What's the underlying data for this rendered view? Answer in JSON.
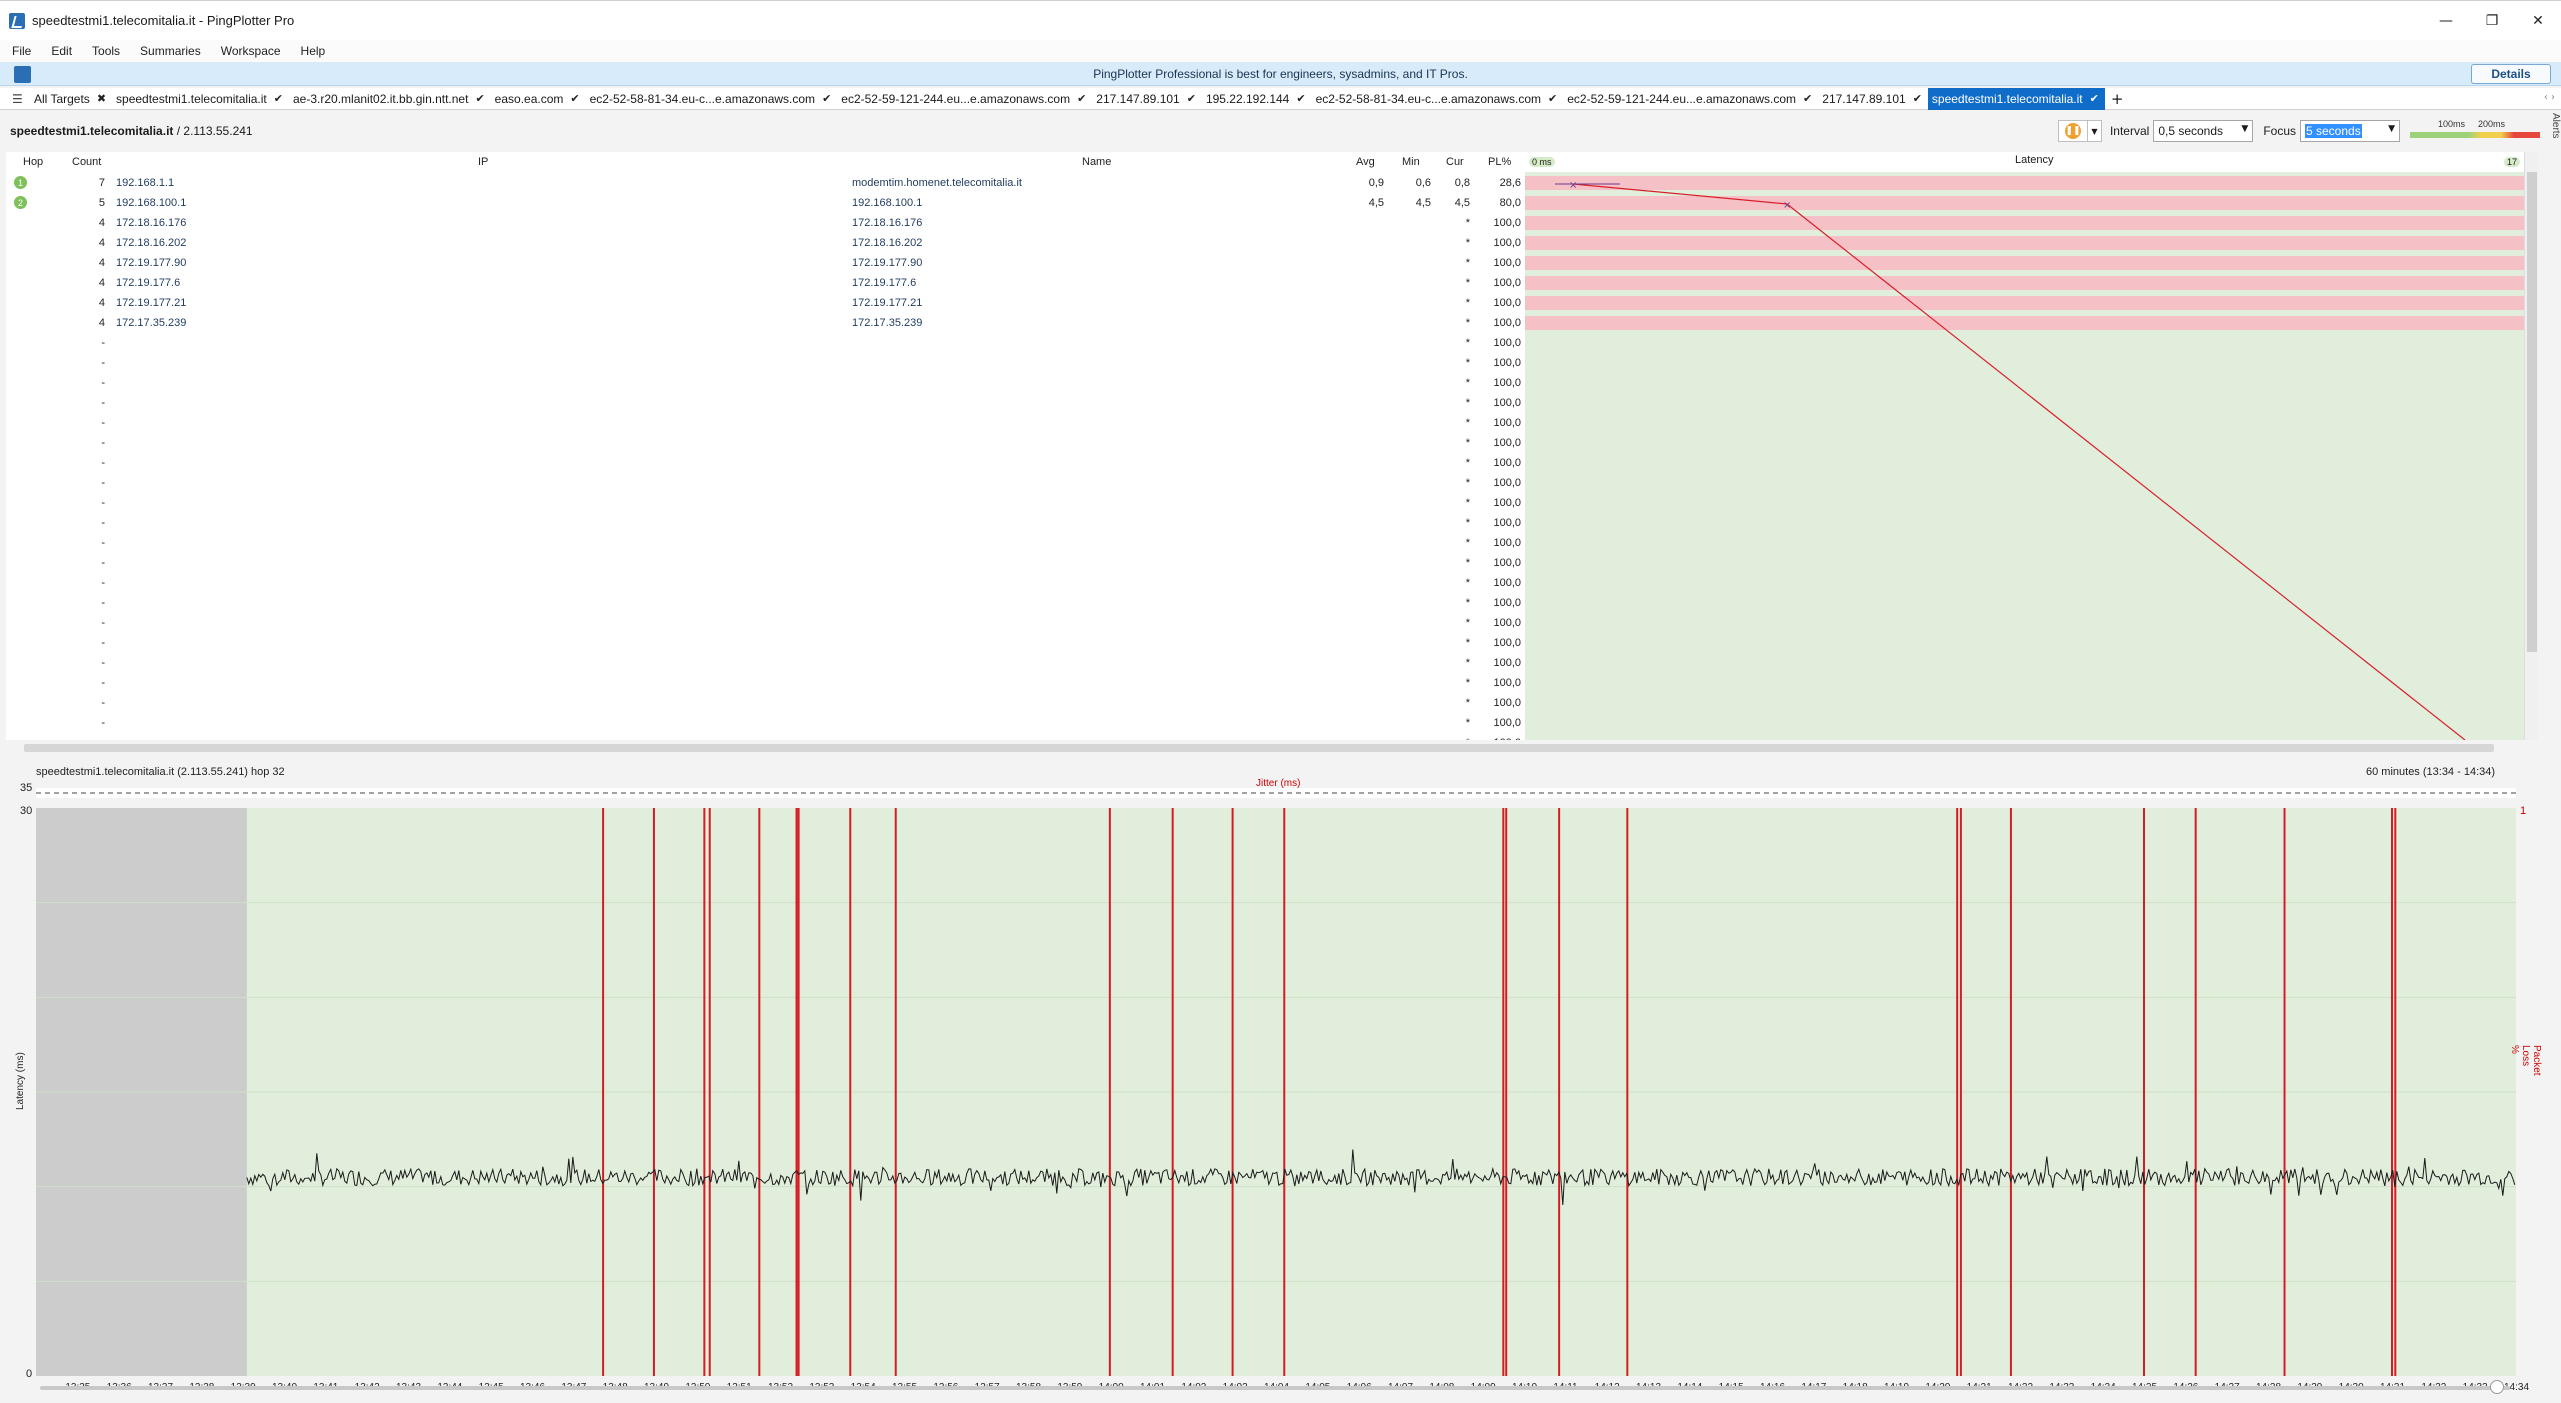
{
  "window": {
    "title": "speedtestmi1.telecomitalia.it - PingPlotter Pro",
    "minimize": "—",
    "restore": "❐",
    "close": "✕"
  },
  "menu": [
    "File",
    "Edit",
    "Tools",
    "Summaries",
    "Workspace",
    "Help"
  ],
  "banner": {
    "text": "PingPlotter Professional is best for engineers, sysadmins, and IT Pros.",
    "details_label": "Details"
  },
  "tabs": [
    {
      "label": "All Targets",
      "mark": "✖"
    },
    {
      "label": "speedtestmi1.telecomitalia.it",
      "mark": "✔"
    },
    {
      "label": "ae-3.r20.mlanit02.it.bb.gin.ntt.net",
      "mark": "✔"
    },
    {
      "label": "easo.ea.com",
      "mark": "✔"
    },
    {
      "label": "ec2-52-58-81-34.eu-c...e.amazonaws.com",
      "mark": "✔"
    },
    {
      "label": "ec2-52-59-121-244.eu...e.amazonaws.com",
      "mark": "✔"
    },
    {
      "label": "217.147.89.101",
      "mark": "✔"
    },
    {
      "label": "195.22.192.144",
      "mark": "✔"
    },
    {
      "label": "ec2-52-58-81-34.eu-c...e.amazonaws.com",
      "mark": "✔"
    },
    {
      "label": "ec2-52-59-121-244.eu...e.amazonaws.com",
      "mark": "✔"
    },
    {
      "label": "217.147.89.101",
      "mark": "✔"
    },
    {
      "label": "speedtestmi1.telecomitalia.it",
      "mark": "✔",
      "active": true
    }
  ],
  "tab_add": "+",
  "toolbar": {
    "target_name": "speedtestmi1.telecomitalia.it",
    "target_ip": " / 2.113.55.241",
    "interval_label": "Interval",
    "interval_value": "0,5 seconds",
    "focus_label": "Focus",
    "focus_value": "5 seconds",
    "scale_100": "100ms",
    "scale_200": "200ms"
  },
  "alerts_label": "Alerts",
  "table": {
    "headers": {
      "hop": "Hop",
      "count": "Count",
      "ip": "IP",
      "name": "Name",
      "avg": "Avg",
      "min": "Min",
      "cur": "Cur",
      "pl": "PL%",
      "latency_min": "0 ms",
      "latency": "Latency",
      "latency_max": "17"
    },
    "rows": [
      {
        "hop": "1",
        "count": "7",
        "ip": "192.168.1.1",
        "name": "modemtim.homenet.telecomitalia.it",
        "avg": "0,9",
        "min": "0,6",
        "cur": "0,8",
        "pl": "28,6"
      },
      {
        "hop": "2",
        "count": "5",
        "ip": "192.168.100.1",
        "name": "192.168.100.1",
        "avg": "4,5",
        "min": "4,5",
        "cur": "4,5",
        "pl": "80,0"
      },
      {
        "hop": "",
        "count": "4",
        "ip": "172.18.16.176",
        "name": "172.18.16.176",
        "avg": "",
        "min": "",
        "cur": "*",
        "pl": "100,0"
      },
      {
        "hop": "",
        "count": "4",
        "ip": "172.18.16.202",
        "name": "172.18.16.202",
        "avg": "",
        "min": "",
        "cur": "*",
        "pl": "100,0"
      },
      {
        "hop": "",
        "count": "4",
        "ip": "172.19.177.90",
        "name": "172.19.177.90",
        "avg": "",
        "min": "",
        "cur": "*",
        "pl": "100,0"
      },
      {
        "hop": "",
        "count": "4",
        "ip": "172.19.177.6",
        "name": "172.19.177.6",
        "avg": "",
        "min": "",
        "cur": "*",
        "pl": "100,0"
      },
      {
        "hop": "",
        "count": "4",
        "ip": "172.19.177.21",
        "name": "172.19.177.21",
        "avg": "",
        "min": "",
        "cur": "*",
        "pl": "100,0"
      },
      {
        "hop": "",
        "count": "4",
        "ip": "172.17.35.239",
        "name": "172.17.35.239",
        "avg": "",
        "min": "",
        "cur": "*",
        "pl": "100,0"
      },
      {
        "hop": "",
        "count": "-",
        "ip": "",
        "name": "",
        "avg": "",
        "min": "",
        "cur": "*",
        "pl": "100,0"
      },
      {
        "hop": "",
        "count": "-",
        "ip": "",
        "name": "",
        "avg": "",
        "min": "",
        "cur": "*",
        "pl": "100,0"
      },
      {
        "hop": "",
        "count": "-",
        "ip": "",
        "name": "",
        "avg": "",
        "min": "",
        "cur": "*",
        "pl": "100,0"
      },
      {
        "hop": "",
        "count": "-",
        "ip": "",
        "name": "",
        "avg": "",
        "min": "",
        "cur": "*",
        "pl": "100,0"
      },
      {
        "hop": "",
        "count": "-",
        "ip": "",
        "name": "",
        "avg": "",
        "min": "",
        "cur": "*",
        "pl": "100,0"
      },
      {
        "hop": "",
        "count": "-",
        "ip": "",
        "name": "",
        "avg": "",
        "min": "",
        "cur": "*",
        "pl": "100,0"
      },
      {
        "hop": "",
        "count": "-",
        "ip": "",
        "name": "",
        "avg": "",
        "min": "",
        "cur": "*",
        "pl": "100,0"
      },
      {
        "hop": "",
        "count": "-",
        "ip": "",
        "name": "",
        "avg": "",
        "min": "",
        "cur": "*",
        "pl": "100,0"
      },
      {
        "hop": "",
        "count": "-",
        "ip": "",
        "name": "",
        "avg": "",
        "min": "",
        "cur": "*",
        "pl": "100,0"
      },
      {
        "hop": "",
        "count": "-",
        "ip": "",
        "name": "",
        "avg": "",
        "min": "",
        "cur": "*",
        "pl": "100,0"
      },
      {
        "hop": "",
        "count": "-",
        "ip": "",
        "name": "",
        "avg": "",
        "min": "",
        "cur": "*",
        "pl": "100,0"
      },
      {
        "hop": "",
        "count": "-",
        "ip": "",
        "name": "",
        "avg": "",
        "min": "",
        "cur": "*",
        "pl": "100,0"
      },
      {
        "hop": "",
        "count": "-",
        "ip": "",
        "name": "",
        "avg": "",
        "min": "",
        "cur": "*",
        "pl": "100,0"
      },
      {
        "hop": "",
        "count": "-",
        "ip": "",
        "name": "",
        "avg": "",
        "min": "",
        "cur": "*",
        "pl": "100,0"
      },
      {
        "hop": "",
        "count": "-",
        "ip": "",
        "name": "",
        "avg": "",
        "min": "",
        "cur": "*",
        "pl": "100,0"
      },
      {
        "hop": "",
        "count": "-",
        "ip": "",
        "name": "",
        "avg": "",
        "min": "",
        "cur": "*",
        "pl": "100,0"
      },
      {
        "hop": "",
        "count": "-",
        "ip": "",
        "name": "",
        "avg": "",
        "min": "",
        "cur": "*",
        "pl": "100,0"
      },
      {
        "hop": "",
        "count": "-",
        "ip": "",
        "name": "",
        "avg": "",
        "min": "",
        "cur": "*",
        "pl": "100,0"
      },
      {
        "hop": "",
        "count": "-",
        "ip": "",
        "name": "",
        "avg": "",
        "min": "",
        "cur": "*",
        "pl": "100,0"
      },
      {
        "hop": "",
        "count": "-",
        "ip": "",
        "name": "",
        "avg": "",
        "min": "",
        "cur": "*",
        "pl": "100,0"
      },
      {
        "hop": "",
        "count": "-",
        "ip": "",
        "name": "",
        "avg": "",
        "min": "",
        "cur": "*",
        "pl": "100,0"
      }
    ]
  },
  "graph": {
    "title": "speedtestmi1.telecomitalia.it (2.113.55.241) hop 32",
    "range": "60 minutes (13:34 - 14:34)",
    "jitter_label": "Jitter (ms)",
    "jitter_max": "35",
    "y_max": "30",
    "y_min": "0",
    "pl_max": "1",
    "latency_axis": "Latency (ms)",
    "pl_axis": "Packet Loss %",
    "time_labels": [
      "13:35",
      "13:36",
      "13:37",
      "13:38",
      "13:39",
      "13:40",
      "13:41",
      "13:42",
      "13:43",
      "13:44",
      "13:45",
      "13:46",
      "13:47",
      "13:48",
      "13:49",
      "13:50",
      "13:51",
      "13:52",
      "13:53",
      "13:54",
      "13:55",
      "13:56",
      "13:57",
      "13:58",
      "13:59",
      "14:00",
      "14:01",
      "14:02",
      "14:03",
      "14:04",
      "14:05",
      "14:06",
      "14:07",
      "14:08",
      "14:09",
      "14:10",
      "14:11",
      "14:12",
      "14:13",
      "14:14",
      "14:15",
      "14:16",
      "14:17",
      "14:18",
      "14:19",
      "14:20",
      "14:21",
      "14:22",
      "14:23",
      "14:24",
      "14:25",
      "14:26",
      "14:27",
      "14:28",
      "14:29",
      "14:30",
      "14:31",
      "14:32",
      "14:33",
      "14:34"
    ],
    "loss_events_min": [
      13.72,
      14.95,
      16.17,
      16.3,
      17.5,
      18.4,
      18.45,
      19.7,
      20.8,
      25.98,
      27.5,
      28.95,
      30.2,
      35.5,
      35.57,
      36.85,
      38.5,
      46.48,
      46.57,
      47.78,
      51.0,
      52.25,
      54.4,
      57.0,
      57.08
    ],
    "latency_ms_typical": 10.5,
    "no_data_until_min": 5.1
  }
}
